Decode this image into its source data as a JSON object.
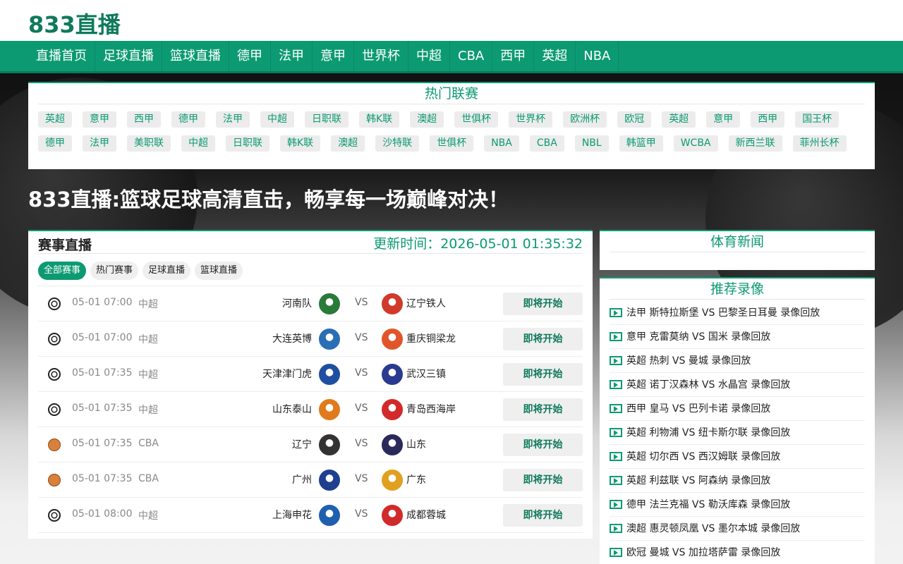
{
  "site": {
    "logo": "833直播"
  },
  "nav": [
    "直播首页",
    "足球直播",
    "篮球直播",
    "德甲",
    "法甲",
    "意甲",
    "世界杯",
    "中超",
    "CBA",
    "西甲",
    "英超",
    "NBA"
  ],
  "hot_leagues": {
    "title": "热门联赛",
    "row1": [
      "英超",
      "意甲",
      "西甲",
      "德甲",
      "法甲",
      "中超",
      "日职联",
      "韩K联",
      "澳超",
      "世俱杯",
      "世界杯",
      "欧洲杯",
      "欧冠",
      "英超",
      "意甲",
      "西甲",
      "国王杯"
    ],
    "row2": [
      "德甲",
      "法甲",
      "美职联",
      "中超",
      "日职联",
      "韩K联",
      "澳超",
      "沙特联",
      "世俱杯",
      "NBA",
      "CBA",
      "NBL",
      "韩篮甲",
      "WCBA",
      "新西兰联",
      "菲州长杯"
    ]
  },
  "headline": "833直播:篮球足球高清直击，畅享每一场巅峰对决！",
  "live": {
    "title": "赛事直播",
    "update_time": "更新时间：2026-05-01 01:35:32",
    "filters": [
      "全部赛事",
      "热门赛事",
      "足球直播",
      "篮球直播"
    ],
    "matches": [
      {
        "sport": "soccer",
        "time": "05-01 07:00",
        "league": "中超",
        "home": "河南队",
        "vs": "VS",
        "away": "辽宁铁人",
        "status": "即将开始",
        "home_color": "#2a7a3a",
        "away_color": "#d03a2a"
      },
      {
        "sport": "soccer",
        "time": "05-01 07:00",
        "league": "中超",
        "home": "大连英博",
        "vs": "VS",
        "away": "重庆铜梁龙",
        "status": "即将开始",
        "home_color": "#2a6fb5",
        "away_color": "#e0562a"
      },
      {
        "sport": "soccer",
        "time": "05-01 07:35",
        "league": "中超",
        "home": "天津津门虎",
        "vs": "VS",
        "away": "武汉三镇",
        "status": "即将开始",
        "home_color": "#1f4fa0",
        "away_color": "#2a3b8f"
      },
      {
        "sport": "soccer",
        "time": "05-01 07:35",
        "league": "中超",
        "home": "山东泰山",
        "vs": "VS",
        "away": "青岛西海岸",
        "status": "即将开始",
        "home_color": "#e07a1a",
        "away_color": "#d22a2a"
      },
      {
        "sport": "basketball",
        "time": "05-01 07:35",
        "league": "CBA",
        "home": "辽宁",
        "vs": "VS",
        "away": "山东",
        "status": "即将开始",
        "home_color": "#333333",
        "away_color": "#2a2a5a"
      },
      {
        "sport": "basketball",
        "time": "05-01 07:35",
        "league": "CBA",
        "home": "广州",
        "vs": "VS",
        "away": "广东",
        "status": "即将开始",
        "home_color": "#1f3f8f",
        "away_color": "#e0a020"
      },
      {
        "sport": "soccer",
        "time": "05-01 08:00",
        "league": "中超",
        "home": "上海申花",
        "vs": "VS",
        "away": "成都蓉城",
        "status": "即将开始",
        "home_color": "#1f5fb0",
        "away_color": "#d02a2a"
      }
    ]
  },
  "news": {
    "title": "体育新闻"
  },
  "recordings": {
    "title": "推荐录像",
    "items": [
      "法甲 斯特拉斯堡 VS 巴黎圣日耳曼 录像回放",
      "意甲 克雷莫纳 VS 国米 录像回放",
      "英超 热刺 VS 曼城 录像回放",
      "英超 诺丁汉森林 VS 水晶宫 录像回放",
      "西甲 皇马 VS 巴列卡诺 录像回放",
      "英超 利物浦 VS 纽卡斯尔联 录像回放",
      "英超 切尔西 VS 西汉姆联 录像回放",
      "英超 利兹联 VS 阿森纳 录像回放",
      "德甲 法兰克福 VS 勒沃库森 录像回放",
      "澳超 惠灵顿凤凰 VS 墨尔本城 录像回放",
      "欧冠 曼城 VS 加拉塔萨雷 录像回放"
    ]
  },
  "colors": {
    "accent": "#0c9a72",
    "logo": "#0f7a5c"
  }
}
